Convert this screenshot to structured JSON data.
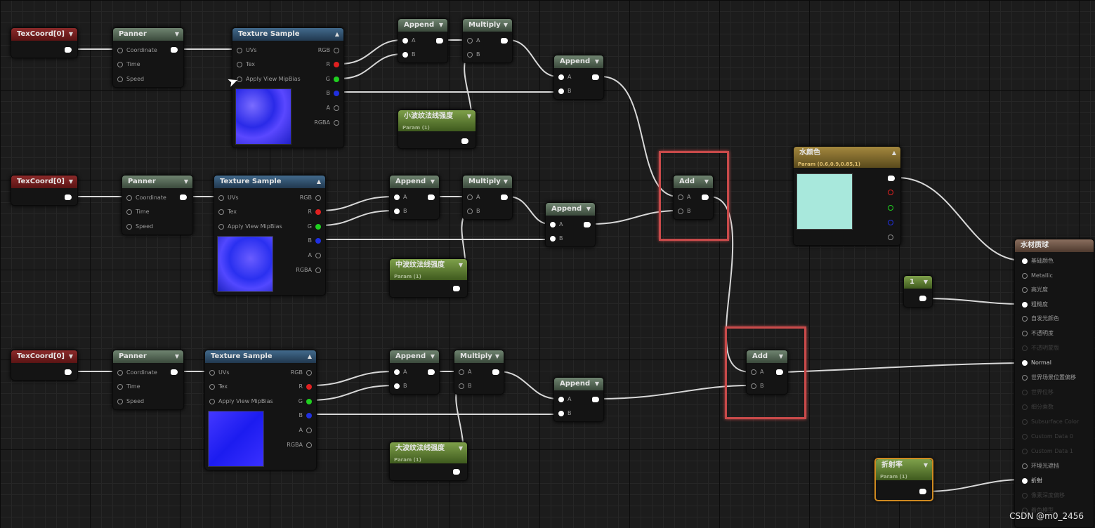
{
  "nodes": {
    "texcoord": [
      "TexCoord[0]",
      "TexCoord[0]",
      "TexCoord[0]"
    ],
    "panner": {
      "title": "Panner",
      "pins": [
        "Coordinate",
        "Time",
        "Speed"
      ]
    },
    "texture_sample": {
      "title": "Texture Sample",
      "inputs": [
        "UVs",
        "Tex",
        "Apply View MipBias"
      ],
      "outputs": [
        "RGB",
        "R",
        "G",
        "B",
        "A",
        "RGBA"
      ]
    },
    "append": {
      "title": "Append",
      "pins": [
        "A",
        "B"
      ]
    },
    "multiply": {
      "title": "Multiply",
      "pins": [
        "A",
        "B"
      ]
    },
    "param": {
      "labels": [
        "小波纹法线强度",
        "中波纹法线强度",
        "大波纹法线强度"
      ],
      "sub": "Param (1)"
    },
    "add": {
      "title": "Add",
      "pins": [
        "A",
        "B"
      ]
    },
    "color": {
      "title": "水颜色",
      "sub": "Param (0.6,0.9,0.85,1)",
      "swatch": "#a8e8dc"
    },
    "const": "1",
    "ior": {
      "title": "折射率",
      "sub": "Param (1)"
    },
    "material": {
      "title": "水材质球",
      "pins": [
        "基础颜色",
        "Metallic",
        "高光度",
        "粗糙度",
        "自发光颜色",
        "不透明度",
        "不透明蒙版",
        "Normal",
        "世界场景位置偏移",
        "世界位移",
        "细分乘数",
        "Subsurface Color",
        "Custom Data 0",
        "Custom Data 1",
        "环境光遮挡",
        "折射",
        "像素深度偏移",
        "着色模型"
      ]
    }
  },
  "watermark": "CSDN @m0_2456"
}
